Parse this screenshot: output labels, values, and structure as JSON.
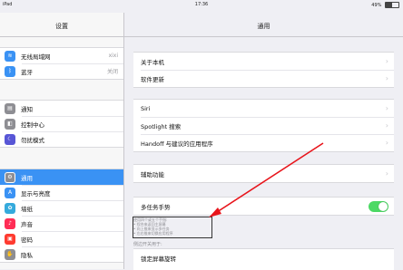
{
  "status": {
    "device": "iPad",
    "time": "17:36",
    "battery": "49%",
    "battery_level": 0.49
  },
  "sidebar": {
    "title": "设置",
    "groups": [
      [
        {
          "label": "无线局域网",
          "value": "xixi",
          "icon": "wifi-icon",
          "color": "#3a92f4"
        },
        {
          "label": "蓝牙",
          "value": "关闭",
          "icon": "bluetooth-icon",
          "color": "#3a92f4"
        }
      ],
      [
        {
          "label": "通知",
          "value": "",
          "icon": "notification-icon",
          "color": "#8e8e93"
        },
        {
          "label": "控制中心",
          "value": "",
          "icon": "control-center-icon",
          "color": "#8e8e93"
        },
        {
          "label": "勿扰模式",
          "value": "",
          "icon": "moon-icon",
          "color": "#5856d6"
        }
      ],
      [
        {
          "label": "通用",
          "value": "",
          "icon": "gear-icon",
          "color": "#8e8e93",
          "selected": true
        },
        {
          "label": "显示与亮度",
          "value": "",
          "icon": "brightness-icon",
          "color": "#3a92f4"
        },
        {
          "label": "墙纸",
          "value": "",
          "icon": "wallpaper-icon",
          "color": "#35aadc"
        },
        {
          "label": "声音",
          "value": "",
          "icon": "sound-icon",
          "color": "#ff2d55"
        },
        {
          "label": "密码",
          "value": "",
          "icon": "passcode-icon",
          "color": "#ff3b30"
        },
        {
          "label": "隐私",
          "value": "",
          "icon": "privacy-icon",
          "color": "#8e8e93"
        }
      ]
    ]
  },
  "main": {
    "title": "通用",
    "group1": [
      "关于本机",
      "软件更新"
    ],
    "group2": [
      "Siri",
      "Spotlight 搜索",
      "Handoff 与建议的应用程序"
    ],
    "group3": [
      "辅助功能"
    ],
    "multitask_label": "多任务手势",
    "footer_lines": [
      "使用四个或五个手指:",
      "• 捏合来返回主屏幕",
      "• 向上推来显示多任务",
      "• 左右推来切换应用程序"
    ],
    "section_label": "侧边开关用于:",
    "last_row": "锁定屏幕旋转"
  },
  "colors": {
    "accent": "#3a92f4",
    "toggle_on": "#4cd964",
    "annotation": "#e8141b"
  }
}
